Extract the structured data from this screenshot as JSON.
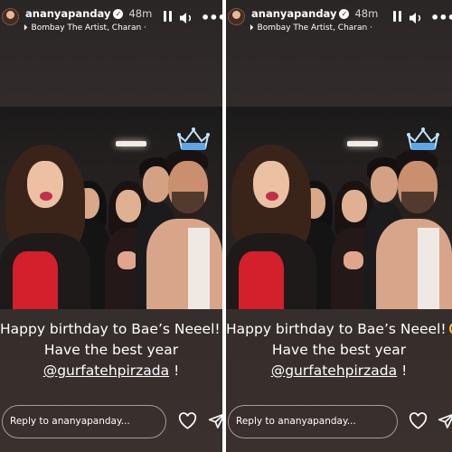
{
  "story": {
    "username": "ananyapanday",
    "time": "48m",
    "music": "Bombay The Artist, Charan ·",
    "caption_line1": "Happy birthday to Bae’s Neeel!",
    "caption_line2": "Have the best year",
    "mention": "@gurfatehpirzada",
    "caption_suffix": " !",
    "reply_placeholder": "Reply to ananyapanday...",
    "sticker": "crown-birthday-sticker"
  },
  "icons": [
    "pause-icon",
    "speaker-icon",
    "more-icon",
    "heart-icon",
    "send-icon",
    "verified-icon",
    "music-icon"
  ],
  "colors": {
    "background": "#2e2828",
    "text": "#ffffff",
    "sticker": "#bfe3ff"
  }
}
